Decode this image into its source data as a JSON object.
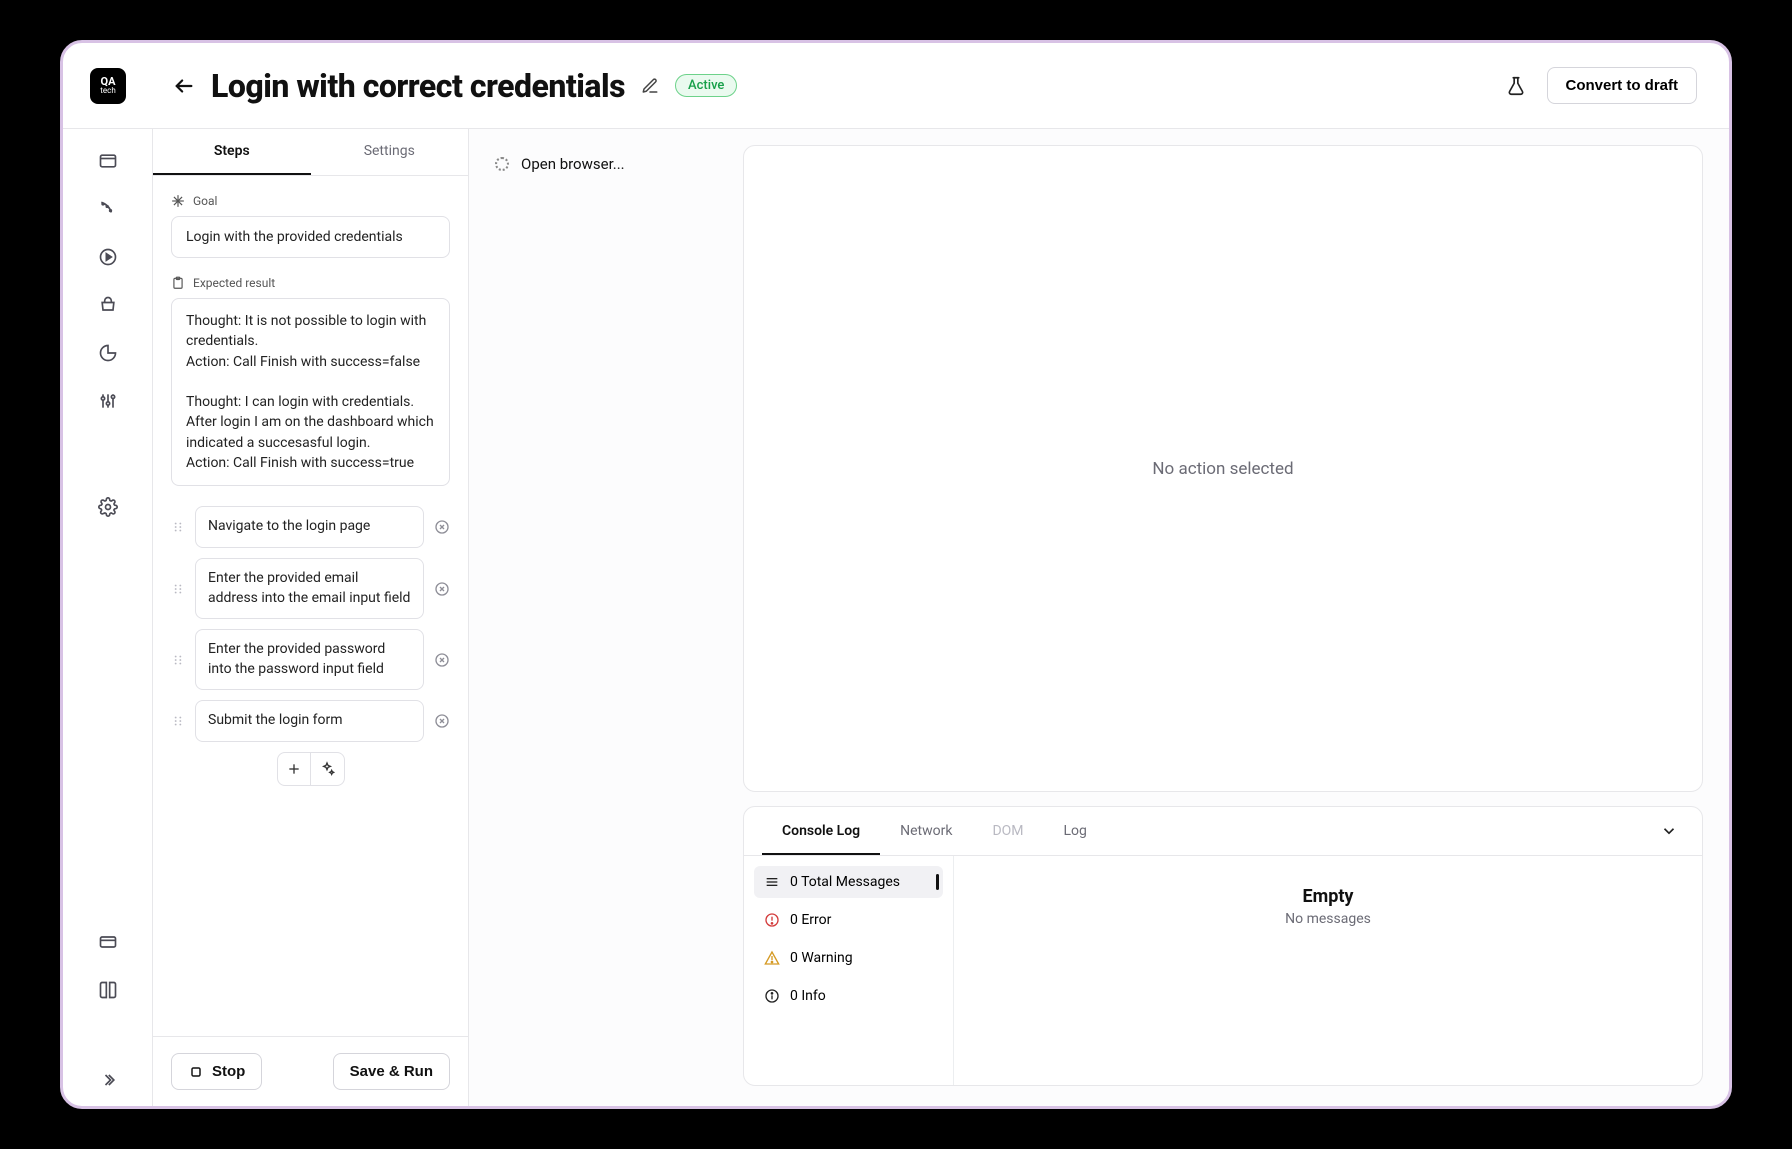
{
  "logo": {
    "line1": "QA",
    "line2": "tech"
  },
  "header": {
    "title": "Login with correct credentials",
    "status": "Active",
    "convert_label": "Convert to draft"
  },
  "sidebar_tabs": {
    "steps": "Steps",
    "settings": "Settings",
    "active": "steps"
  },
  "goal": {
    "label": "Goal",
    "value": "Login with the provided credentials"
  },
  "expected": {
    "label": "Expected result",
    "value": "Thought: It is not possible to login with credentials.\nAction: Call Finish with success=false\n\nThought: I can login with credentials. After login I am on the dashboard which indicated a succesasful login.\nAction: Call Finish with success=true"
  },
  "steps": [
    "Navigate to the login page",
    "Enter the provided email address into the email input field",
    "Enter the provided password into the password input field",
    "Submit the login form"
  ],
  "footer": {
    "stop": "Stop",
    "save_run": "Save & Run"
  },
  "runlog": {
    "open_browser": "Open browser..."
  },
  "preview": {
    "empty": "No action selected"
  },
  "console": {
    "tabs": {
      "console": "Console Log",
      "network": "Network",
      "dom": "DOM",
      "log": "Log"
    },
    "filters": {
      "total": "0 Total Messages",
      "error": "0 Error",
      "warning": "0 Warning",
      "info": "0 Info"
    },
    "empty_title": "Empty",
    "empty_sub": "No messages"
  }
}
